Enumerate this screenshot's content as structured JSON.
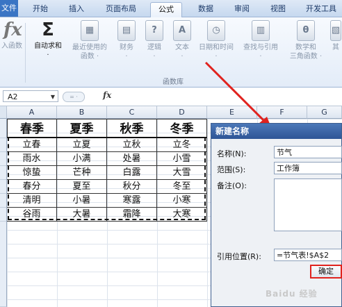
{
  "ribbon_tabs": [
    "文件",
    "开始",
    "插入",
    "页面布局",
    "公式",
    "数据",
    "审阅",
    "视图",
    "开发工具"
  ],
  "ribbon": {
    "buttons": [
      {
        "icon": "fx",
        "label1": "入函数",
        "label2": ""
      },
      {
        "icon": "Σ",
        "label1": "自动求和",
        "label2": ""
      },
      {
        "icon": "▦",
        "label1": "最近使用的",
        "label2": "函数 ·"
      },
      {
        "icon": "▤",
        "label1": "财务",
        "label2": "·"
      },
      {
        "icon": "?",
        "label1": "逻辑",
        "label2": "·"
      },
      {
        "icon": "A",
        "label1": "文本",
        "label2": "·"
      },
      {
        "icon": "◷",
        "label1": "日期和时间",
        "label2": "·"
      },
      {
        "icon": "▥",
        "label1": "查找与引用",
        "label2": "·"
      },
      {
        "icon": "θ",
        "label1": "数学和",
        "label2": "三角函数 ·"
      },
      {
        "icon": "▧",
        "label1": "其",
        "label2": ""
      }
    ],
    "group_label": "函数库"
  },
  "formula_bar": {
    "name_box": "A2",
    "fx": "fx",
    "toggle": "= ·"
  },
  "columns": [
    "A",
    "B",
    "C",
    "D",
    "E",
    "F",
    "G"
  ],
  "table": {
    "headers": [
      "春季",
      "夏季",
      "秋季",
      "冬季"
    ],
    "rows": [
      [
        "立春",
        "立夏",
        "立秋",
        "立冬"
      ],
      [
        "雨水",
        "小满",
        "处暑",
        "小雪"
      ],
      [
        "惊蛰",
        "芒种",
        "白露",
        "大雪"
      ],
      [
        "春分",
        "夏至",
        "秋分",
        "冬至"
      ],
      [
        "清明",
        "小暑",
        "寒露",
        "小寒"
      ],
      [
        "谷雨",
        "大暑",
        "霜降",
        "大寒"
      ]
    ]
  },
  "dialog": {
    "title": "新建名称",
    "name_label": "名称(N):",
    "name_value": "节气",
    "scope_label": "范围(S):",
    "scope_value": "工作簿",
    "comment_label": "备注(O):",
    "refers_label": "引用位置(R):",
    "refers_value": "=节气表!$A$2",
    "ok_label": "确定"
  },
  "watermark": "Baidu 经验",
  "colors": {
    "annotation": "#e0221e",
    "dialog_title": "#2e5596"
  }
}
